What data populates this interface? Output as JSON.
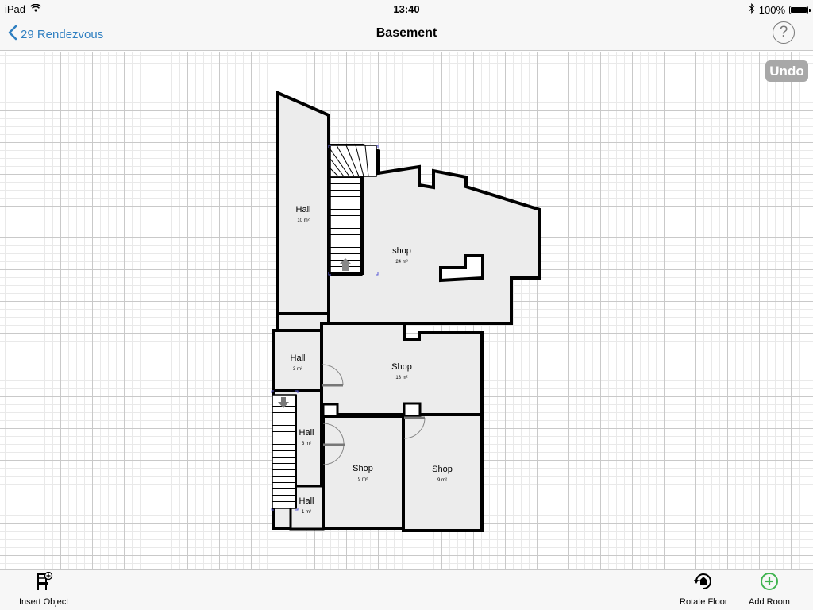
{
  "status_bar": {
    "device": "iPad",
    "time": "13:40",
    "battery": "100%",
    "battery_level": 1.0
  },
  "nav": {
    "back_label": "29 Rendezvous",
    "title": "Basement",
    "help_label": "?"
  },
  "undo_label": "Undo",
  "rooms": [
    {
      "name": "Hall",
      "area": "10 m²"
    },
    {
      "name": "shop",
      "area": "24 m²"
    },
    {
      "name": "Hall",
      "area": "3 m²"
    },
    {
      "name": "Shop",
      "area": "13 m²"
    },
    {
      "name": "Hall",
      "area": "3 m²"
    },
    {
      "name": "Shop",
      "area": "9 m²"
    },
    {
      "name": "Shop",
      "area": "9 m²"
    },
    {
      "name": "Hall",
      "area": "1 m²"
    }
  ],
  "toolbar": {
    "insert_object_label": "Insert Object",
    "rotate_floor_label": "Rotate Floor",
    "add_room_label": "Add Room"
  },
  "colors": {
    "accent": "#2f7fc1",
    "add_green": "#3fb34f",
    "room_fill": "#ececec",
    "wall": "#000000",
    "undo_bg": "#a8a8a8"
  }
}
